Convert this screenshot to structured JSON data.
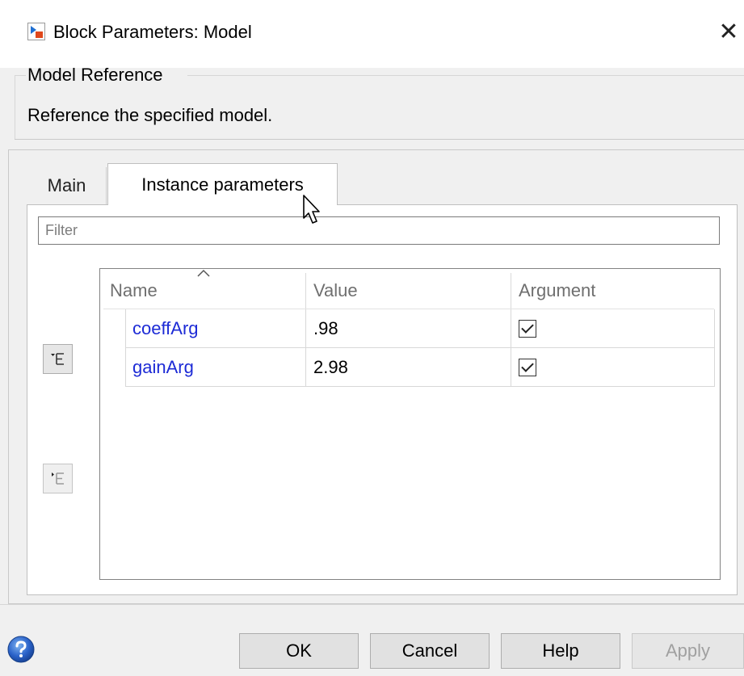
{
  "window": {
    "title": "Block Parameters: Model",
    "close_glyph": "✕"
  },
  "group": {
    "legend": "Model Reference",
    "description": "Reference the specified model."
  },
  "tabs": [
    {
      "label": "Main",
      "active": false
    },
    {
      "label": "Instance parameters",
      "active": true
    }
  ],
  "filter": {
    "placeholder": "Filter",
    "value": ""
  },
  "table": {
    "columns": [
      "Name",
      "Value",
      "Argument"
    ],
    "sorted_by": "Name",
    "rows": [
      {
        "name": "coeffArg",
        "value": ".98",
        "argument": true
      },
      {
        "name": "gainArg",
        "value": "2.98",
        "argument": true
      }
    ]
  },
  "side_buttons": [
    {
      "icon": "expand-tree-icon",
      "enabled": true
    },
    {
      "icon": "collapse-tree-icon",
      "enabled": false
    }
  ],
  "buttons": {
    "ok": "OK",
    "cancel": "Cancel",
    "help": "Help",
    "apply": "Apply"
  },
  "colors": {
    "link_text": "#1d2bd6",
    "disabled_text": "#a0a0a0"
  }
}
